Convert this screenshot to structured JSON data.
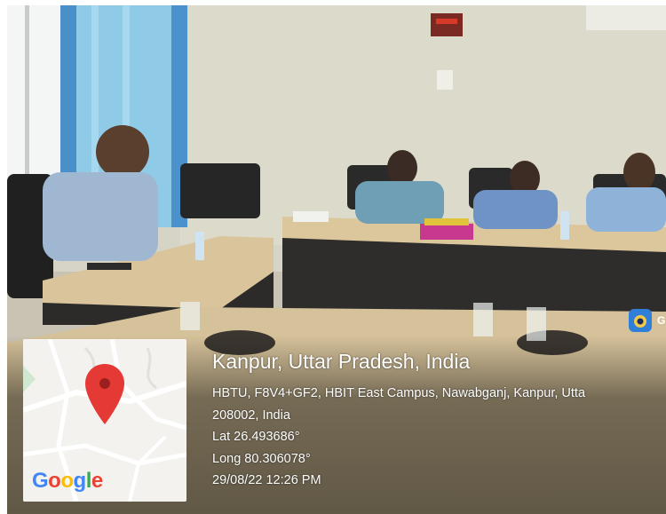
{
  "overlay": {
    "title": "Kanpur, Uttar Pradesh, India",
    "address_line1": "HBTU, F8V4+GF2, HBIT East Campus, Nawabganj, Kanpur, Utta",
    "address_line2": "208002, India",
    "lat": "Lat 26.493686°",
    "long": "Long 80.306078°",
    "datetime": "29/08/22 12:26 PM"
  },
  "map": {
    "logo_text": "Google",
    "logo_colors": [
      "#4285F4",
      "#EA4335",
      "#FBBC05",
      "#4285F4",
      "#34A853",
      "#EA4335"
    ],
    "pin_color": "#E53935",
    "pin_icon": "map-pin-icon"
  },
  "badge": {
    "app_letter": "G",
    "icon": "gps-camera-icon"
  }
}
